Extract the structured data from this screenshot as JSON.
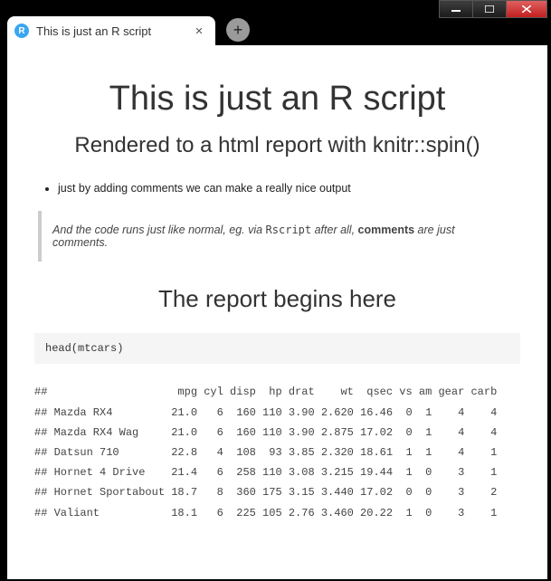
{
  "window": {
    "controls": {
      "min": "min",
      "max": "max",
      "close": "close"
    }
  },
  "tab": {
    "favicon_letter": "R",
    "title": "This is just an R script"
  },
  "doc": {
    "title": "This is just an R script",
    "subtitle": "Rendered to a html report with knitr::spin()",
    "bullets": [
      "just by adding comments we can make a really nice output"
    ],
    "quote_pre": "And the code runs just like normal, eg. via ",
    "quote_code": "Rscript",
    "quote_mid": " after all, ",
    "quote_bold": "comments",
    "quote_post": " are just comments.",
    "section": "The report begins here",
    "code": "head(mtcars)",
    "output_header": "##                    mpg cyl disp  hp drat    wt  qsec vs am gear carb",
    "output_rows": [
      "## Mazda RX4         21.0   6  160 110 3.90 2.620 16.46  0  1    4    4",
      "## Mazda RX4 Wag     21.0   6  160 110 3.90 2.875 17.02  0  1    4    4",
      "## Datsun 710        22.8   4  108  93 3.85 2.320 18.61  1  1    4    1",
      "## Hornet 4 Drive    21.4   6  258 110 3.08 3.215 19.44  1  0    3    1",
      "## Hornet Sportabout 18.7   8  360 175 3.15 3.440 17.02  0  0    3    2",
      "## Valiant           18.1   6  225 105 2.76 3.460 20.22  1  0    3    1"
    ]
  }
}
